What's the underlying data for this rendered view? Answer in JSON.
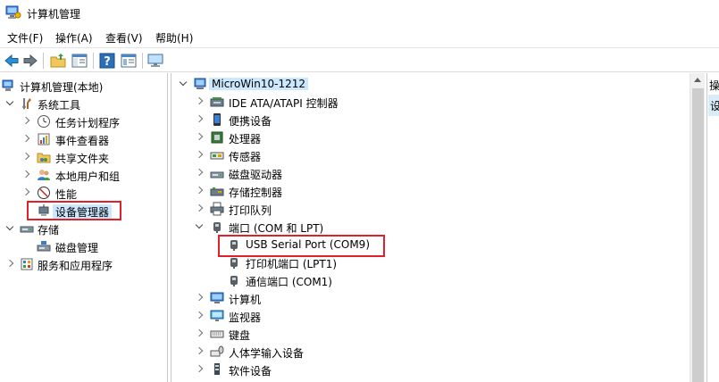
{
  "window": {
    "title": "计算机管理",
    "icon": "computer-management-icon"
  },
  "menu": [
    "文件(F)",
    "操作(A)",
    "查看(V)",
    "帮助(H)"
  ],
  "toolbar": [
    "back-arrow-icon",
    "forward-arrow-icon",
    "up-folder-icon",
    "show-hide-tree-icon",
    "help-icon",
    "properties-icon",
    "monitor-icon"
  ],
  "left_tree": {
    "root": "计算机管理(本地)",
    "system_tools": "系统工具",
    "task_scheduler": "任务计划程序",
    "event_viewer": "事件查看器",
    "shared_folders": "共享文件夹",
    "local_users": "本地用户和组",
    "performance": "性能",
    "device_manager": "设备管理器",
    "storage": "存储",
    "disk_management": "磁盘管理",
    "services_apps": "服务和应用程序"
  },
  "device_tree": {
    "computer_name": "MicroWin10-1212",
    "ide": "IDE ATA/ATAPI 控制器",
    "portable": "便携设备",
    "processors": "处理器",
    "sensors": "传感器",
    "disk_drives": "磁盘驱动器",
    "storage_controllers": "存储控制器",
    "print_queues": "打印队列",
    "ports": "端口 (COM 和 LPT)",
    "usb_serial": "USB Serial Port (COM9)",
    "printer_port": "打印机端口 (LPT1)",
    "comm_port": "通信端口 (COM1)",
    "computer": "计算机",
    "monitors": "监视器",
    "keyboards": "键盘",
    "hid": "人体学输入设备",
    "software_devices": "软件设备"
  },
  "action_pane": {
    "header": "操",
    "selected": "设"
  },
  "highlight_color": "#e0202a"
}
